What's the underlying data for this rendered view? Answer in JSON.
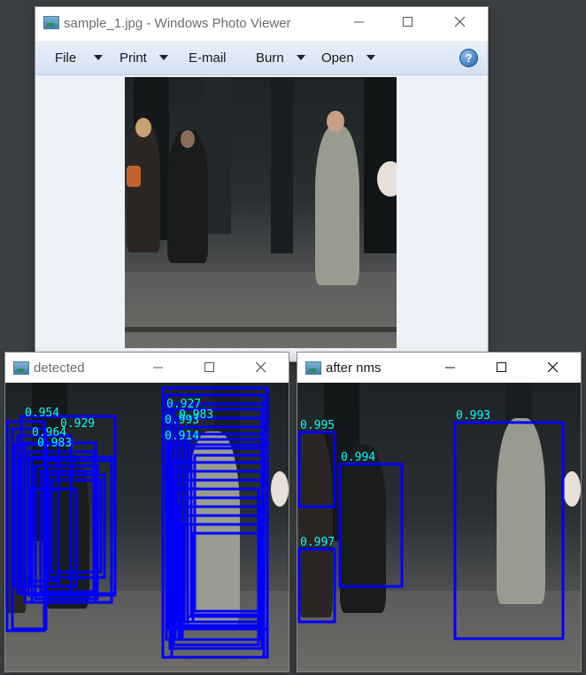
{
  "viewer": {
    "title": "sample_1.jpg - Windows Photo Viewer",
    "menu": [
      {
        "label": "File",
        "has_dropdown": true
      },
      {
        "label": "Print",
        "has_dropdown": true
      },
      {
        "label": "E-mail",
        "has_dropdown": false
      },
      {
        "label": "Burn",
        "has_dropdown": true
      },
      {
        "label": "Open",
        "has_dropdown": true
      }
    ],
    "help_glyph": "?",
    "controls": [
      "minimize-icon",
      "maximize-icon",
      "close-icon"
    ]
  },
  "detected": {
    "title": "detected",
    "box_color": "#0000ff",
    "label_color": "#00ffff",
    "visible_scores": [
      "0.954",
      "0.929",
      "0.964",
      "0.983",
      "0.993",
      "0.914",
      "0.927",
      "0.983"
    ]
  },
  "after_nms": {
    "title": "after nms",
    "box_color": "#0000ff",
    "label_color": "#00ffff",
    "detections": [
      {
        "score": "0.995"
      },
      {
        "score": "0.994"
      },
      {
        "score": "0.997"
      },
      {
        "score": "0.993"
      }
    ]
  },
  "colors": {
    "desktop": "#3c3f41",
    "menubar": "#d4e1f2",
    "viewer_background": "#eef2f8"
  }
}
